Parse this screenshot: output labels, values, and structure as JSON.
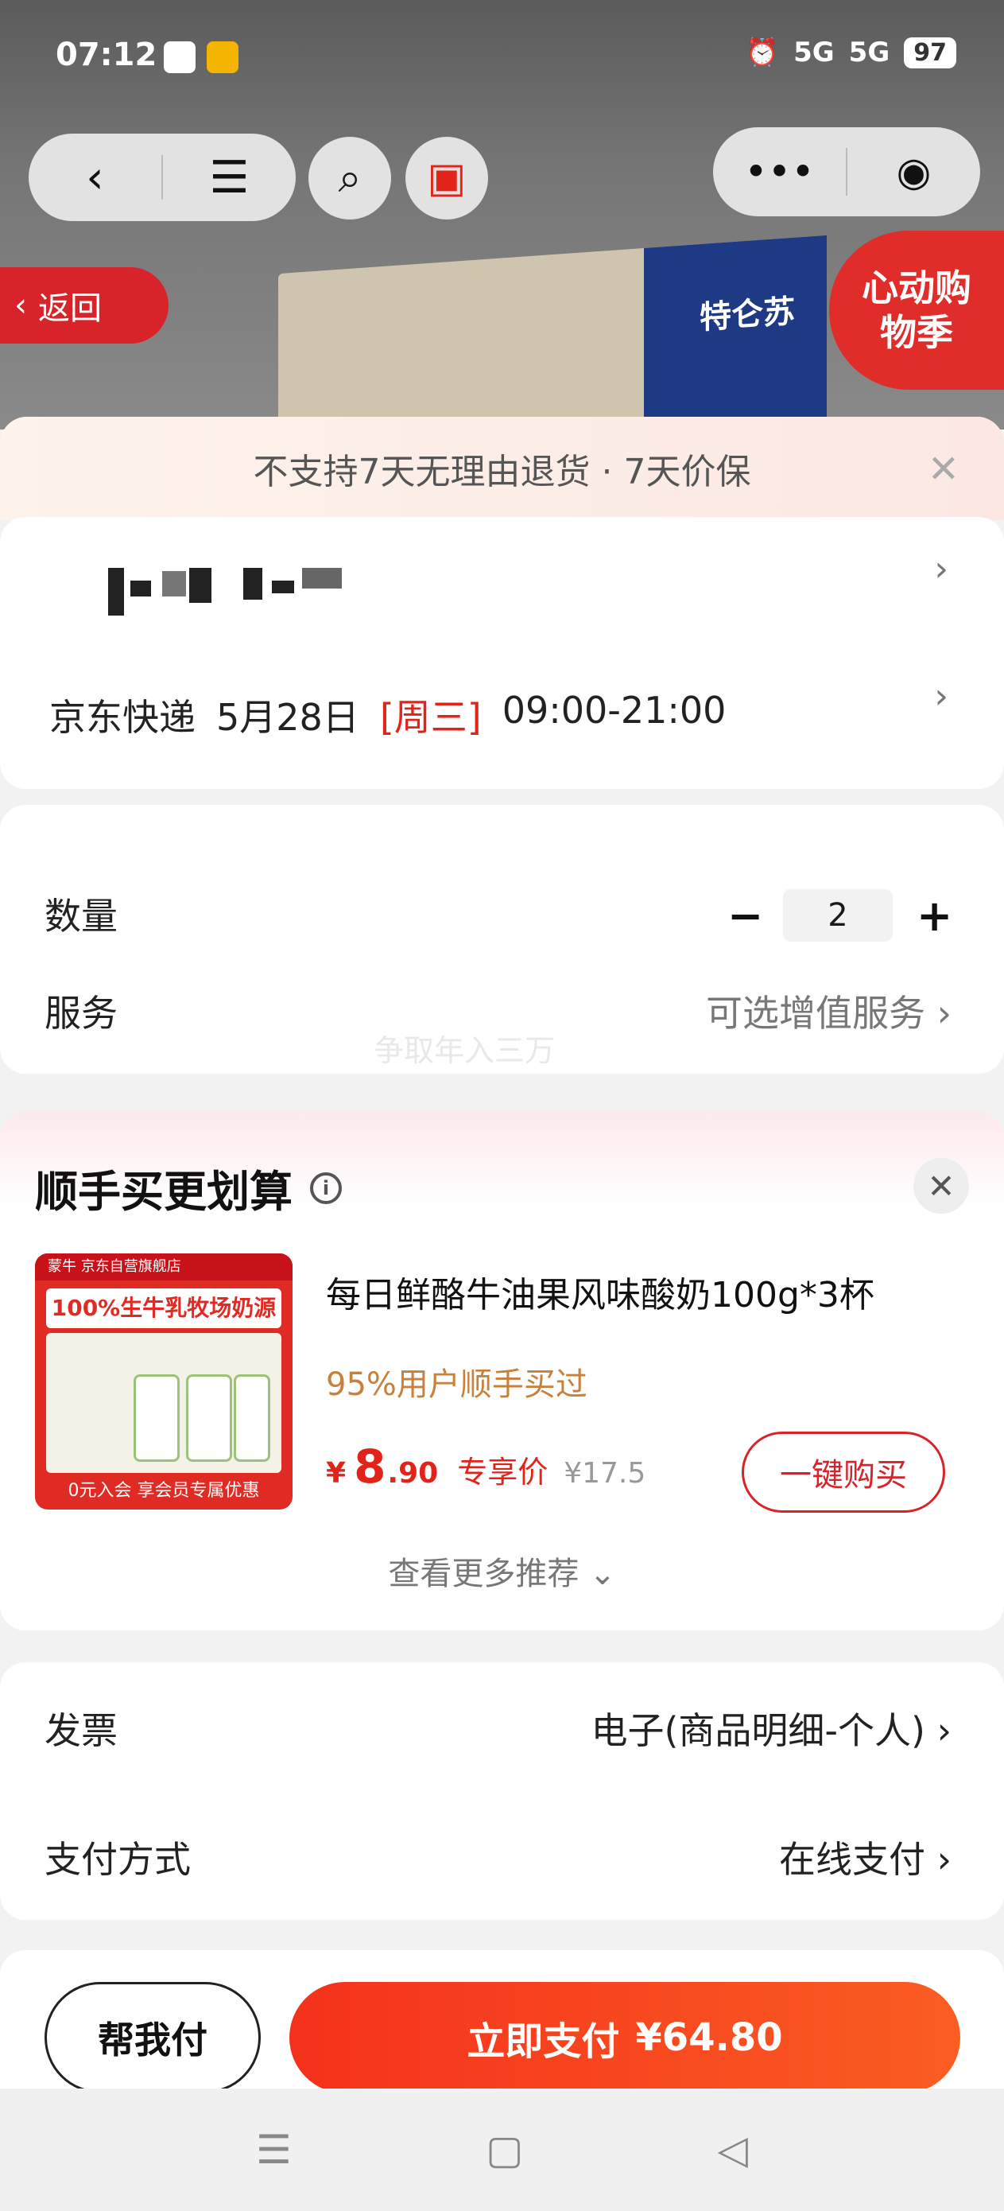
{
  "status_bar": {
    "time": "07:12",
    "signal1": "5G",
    "signal2": "5G",
    "battery": "97"
  },
  "mini_nav": {
    "back_icon": "chevron-left-icon",
    "menu_icon": "menu-icon",
    "search_icon": "search-icon",
    "gift_icon": "gift-icon",
    "more_icon": "more-dots-icon",
    "target_icon": "target-icon"
  },
  "hero": {
    "back_label": "返回",
    "promo_label": "心动购物季",
    "box_brand": "特仑苏"
  },
  "notice": {
    "text": "不支持7天无理由退货 · 7天价保"
  },
  "delivery": {
    "carrier": "京东快递",
    "date": "5月28日",
    "weekday": "[周三]",
    "time": "09:00-21:00"
  },
  "quantity": {
    "label": "数量",
    "minus": "−",
    "value": "2",
    "plus": "+"
  },
  "service": {
    "label": "服务",
    "value": "可选增值服务",
    "watermark": "争取年入三万"
  },
  "recommend": {
    "title": "顺手买更划算",
    "product_name": "每日鲜酪牛油果风味酸奶100g*3杯",
    "social_proof": "95%用户顺手买过",
    "price_currency": "¥",
    "price_int": "8",
    "price_dec": ".90",
    "price_label": "专享价",
    "orig_price": "¥17.5",
    "buy_label": "一键购买",
    "more_label": "查看更多推荐",
    "image": {
      "store": "蒙牛  京东自营旗舰店",
      "headline": "100%生牛乳牧场奶源",
      "footer": "0元入会 享会员专属优惠"
    }
  },
  "invoice": {
    "label": "发票",
    "value": "电子(商品明细-个人)"
  },
  "payment": {
    "label": "支付方式",
    "value": "在线支付"
  },
  "actions": {
    "help_label": "帮我付",
    "pay_label": "立即支付",
    "pay_amount": "¥64.80"
  },
  "colors": {
    "accent": "#e2231a",
    "pay_gradient_start": "#f5311c",
    "pay_gradient_end": "#fa5d22"
  }
}
